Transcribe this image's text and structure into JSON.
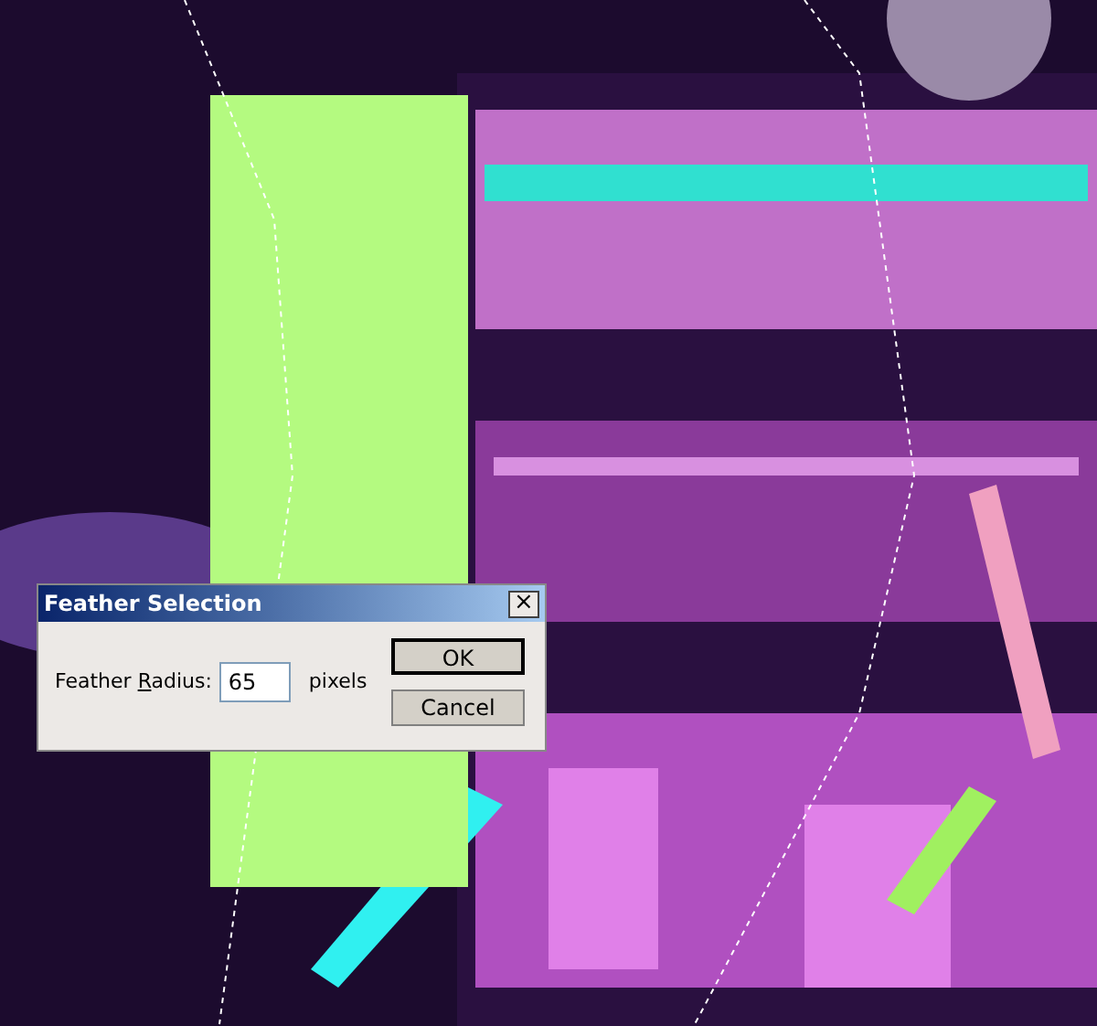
{
  "dialog": {
    "title": "Feather Selection",
    "close": "×",
    "field": {
      "label_before": "Feather ",
      "label_key": "R",
      "label_after": "adius:",
      "value": "65",
      "unit": "pixels"
    },
    "buttons": [
      {
        "label": "OK",
        "default": true
      },
      {
        "label": "Cancel",
        "default": false
      }
    ]
  }
}
